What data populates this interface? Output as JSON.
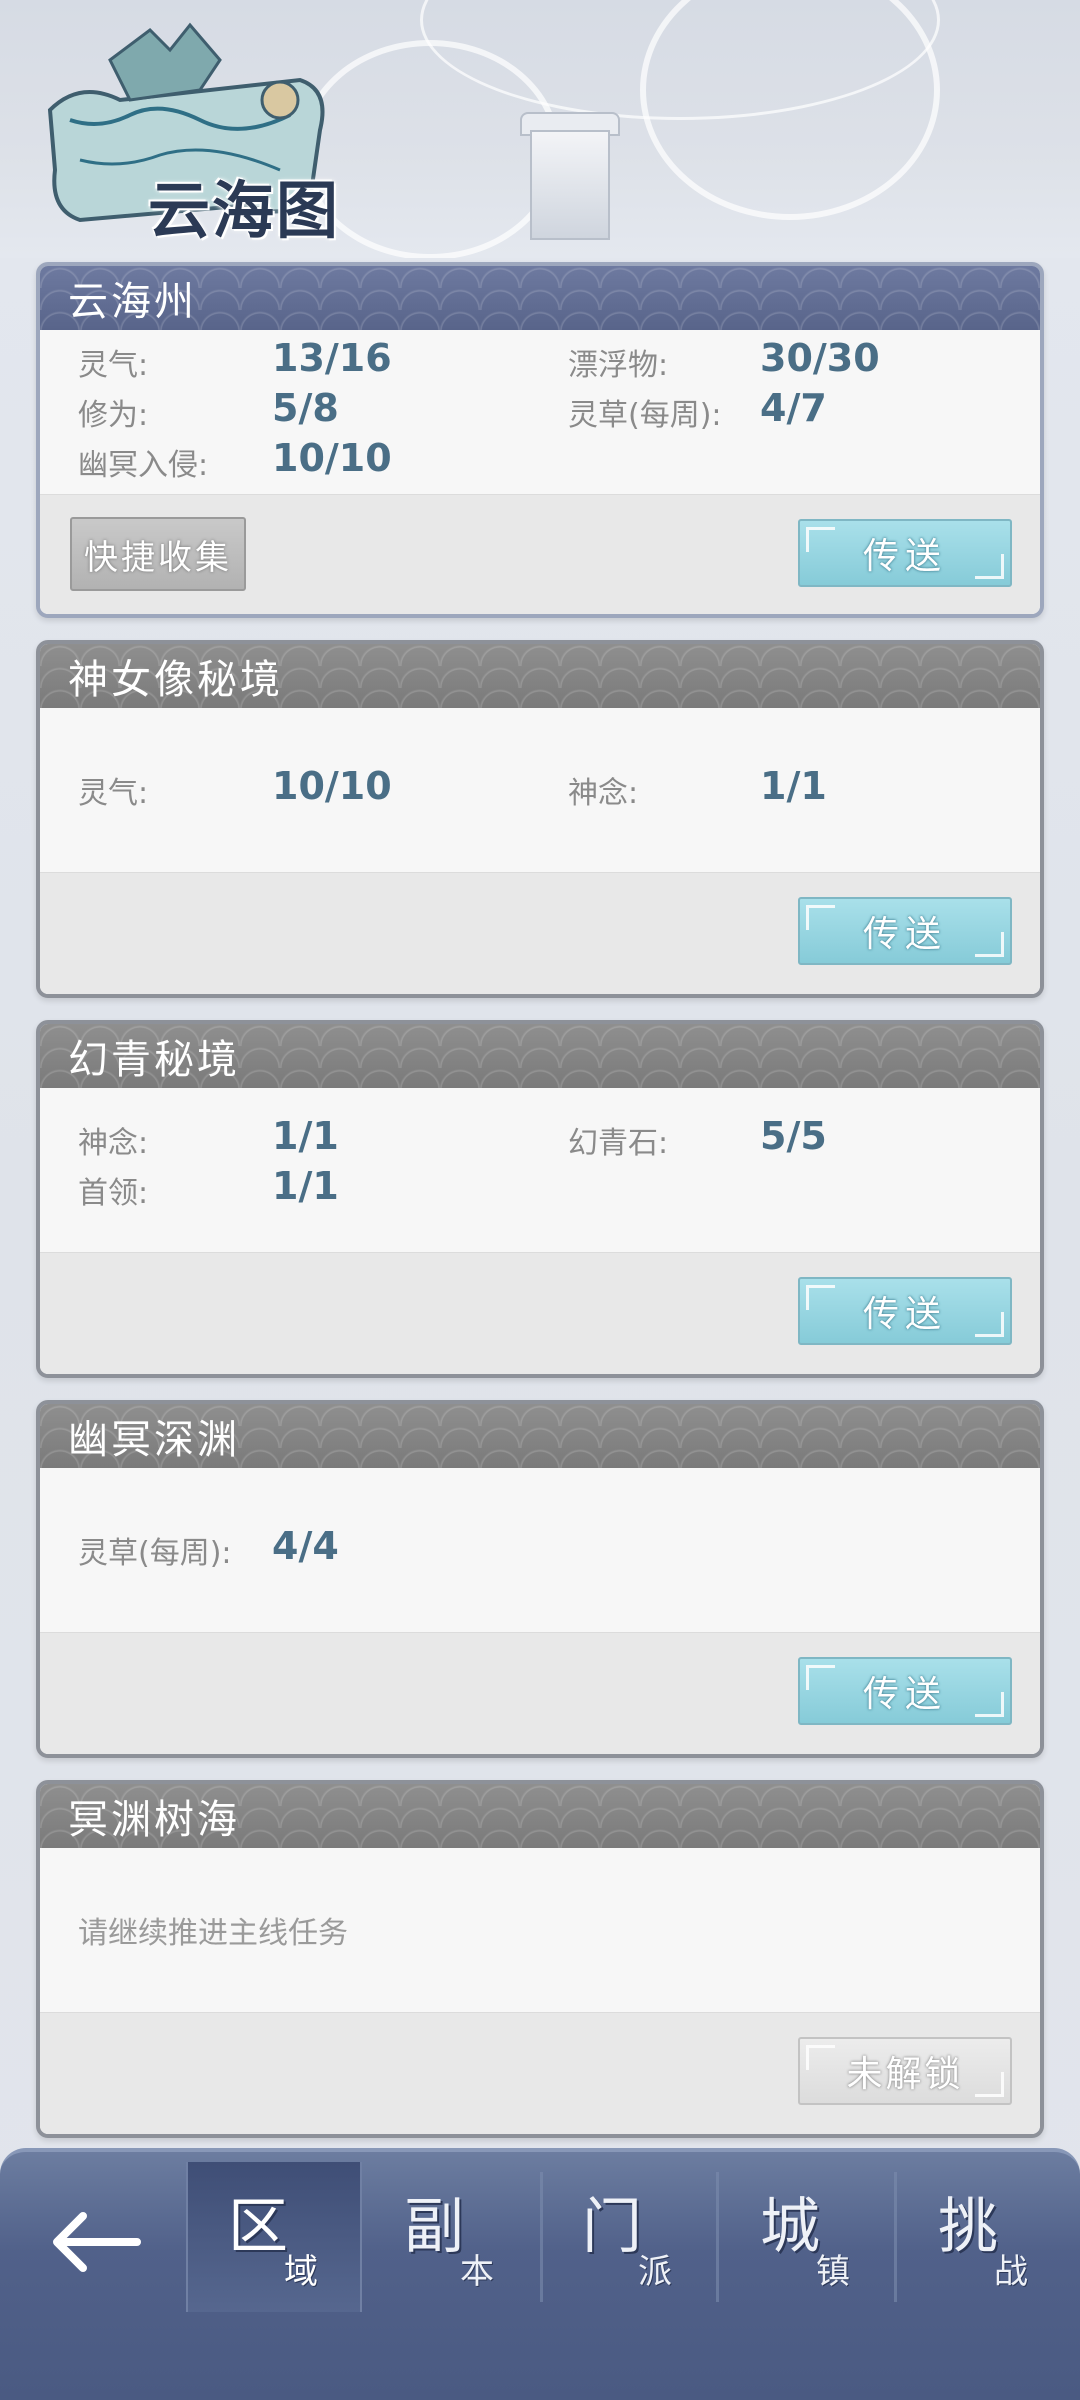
{
  "header": {
    "title": "云海图"
  },
  "regions": [
    {
      "title": "云海州",
      "stats_left": [
        {
          "label": "灵气:",
          "value": "13/16"
        },
        {
          "label": "修为:",
          "value": "5/8"
        },
        {
          "label": "幽冥入侵:",
          "value": "10/10"
        }
      ],
      "stats_right": [
        {
          "label": "漂浮物:",
          "value": "30/30"
        },
        {
          "label": "灵草(每周):",
          "value": "4/7"
        }
      ],
      "collect_label": "快捷收集",
      "action_label": "传送"
    },
    {
      "title": "神女像秘境",
      "stats_left": [
        {
          "label": "灵气:",
          "value": "10/10"
        }
      ],
      "stats_right": [
        {
          "label": "神念:",
          "value": "1/1"
        }
      ],
      "action_label": "传送"
    },
    {
      "title": "幻青秘境",
      "stats_left": [
        {
          "label": "神念:",
          "value": "1/1"
        },
        {
          "label": "首领:",
          "value": "1/1"
        }
      ],
      "stats_right": [
        {
          "label": "幻青石:",
          "value": "5/5"
        }
      ],
      "action_label": "传送"
    },
    {
      "title": "幽冥深渊",
      "stats_left": [
        {
          "label": "灵草(每周):",
          "value": "4/4"
        }
      ],
      "action_label": "传送"
    },
    {
      "title": "冥渊树海",
      "info": "请继续推进主线任务",
      "action_label": "未解锁"
    }
  ],
  "nav": {
    "back_icon": "back-arrow-icon",
    "tabs": [
      {
        "big": "区",
        "small": "域"
      },
      {
        "big": "副",
        "small": "本"
      },
      {
        "big": "门",
        "small": "派"
      },
      {
        "big": "城",
        "small": "镇"
      },
      {
        "big": "挑",
        "small": "战"
      }
    ]
  },
  "colors": {
    "accent_header": "#5d6990",
    "value_text": "#4a6e86",
    "teleport_button": "#8fd1dd",
    "nav_bg": "#51618a"
  }
}
